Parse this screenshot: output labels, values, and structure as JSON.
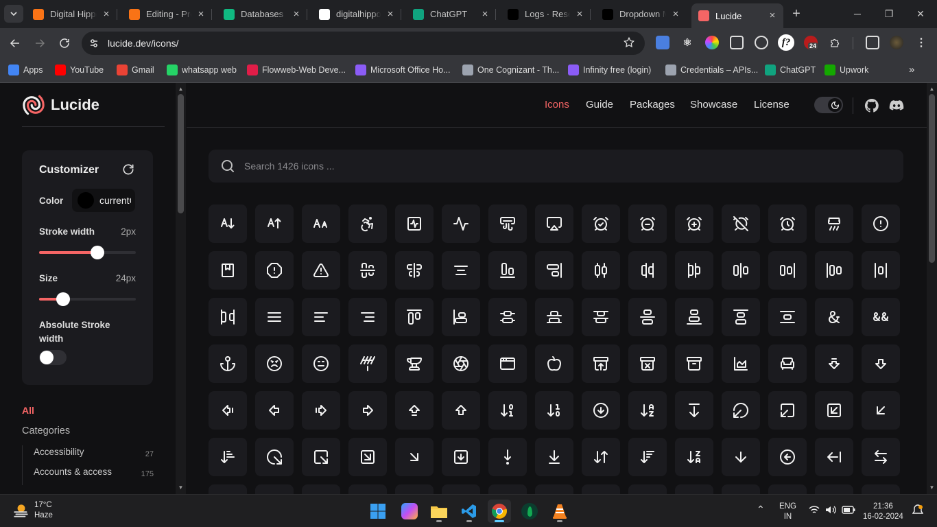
{
  "browser": {
    "tabs": [
      {
        "title": "Digital Hippo",
        "icon": "digitalhippo-icon",
        "color": "#f97316"
      },
      {
        "title": "Editing - Pro",
        "icon": "digitalhippo-icon",
        "color": "#f97316"
      },
      {
        "title": "Databases | C",
        "icon": "mongodb-icon",
        "color": "#10b981"
      },
      {
        "title": "digitalhippo",
        "icon": "github-icon",
        "color": "#ffffff"
      },
      {
        "title": "ChatGPT",
        "icon": "chatgpt-icon",
        "color": "#10a37f"
      },
      {
        "title": "Logs · Resen",
        "icon": "resend-icon",
        "color": "#000000"
      },
      {
        "title": "Dropdown M",
        "icon": "shadcn-icon",
        "color": "#000000"
      },
      {
        "title": "Lucide",
        "icon": "lucide-icon",
        "color": "#f56565",
        "active": true
      }
    ],
    "url": "lucide.dev/icons/",
    "bookmarks": [
      {
        "label": "Apps",
        "icon": "apps-grid-icon",
        "color": "#4285f4"
      },
      {
        "label": "YouTube",
        "icon": "youtube-icon",
        "color": "#ff0000"
      },
      {
        "label": "Gmail",
        "icon": "gmail-icon",
        "color": "#ea4335"
      },
      {
        "label": "whatsapp web",
        "icon": "whatsapp-icon",
        "color": "#25d366"
      },
      {
        "label": "Flowweb-Web Deve...",
        "icon": "flowweb-icon",
        "color": "#e11d48"
      },
      {
        "label": "Microsoft Office Ho...",
        "icon": "office-icon",
        "color": "#8b5cf6"
      },
      {
        "label": "One Cognizant - Th...",
        "icon": "globe-icon",
        "color": "#9ca3af"
      },
      {
        "label": "Infinity free (login)",
        "icon": "infinity-icon",
        "color": "#8b5cf6"
      },
      {
        "label": "Credentials – APIs...",
        "icon": "gcp-icon",
        "color": "#9ca3af"
      },
      {
        "label": "ChatGPT",
        "icon": "chatgpt-icon",
        "color": "#10a37f"
      },
      {
        "label": "Upwork",
        "icon": "upwork-icon",
        "color": "#14a800"
      }
    ],
    "extension_badge": "24"
  },
  "site": {
    "brand": "Lucide",
    "nav": [
      "Icons",
      "Guide",
      "Packages",
      "Showcase",
      "License"
    ],
    "nav_active": "Icons",
    "accent": "#f56565",
    "search_placeholder": "Search 1426 icons ..."
  },
  "customizer": {
    "title": "Customizer",
    "color_label": "Color",
    "color_value": "currentColor",
    "stroke_label": "Stroke width",
    "stroke_value": "2px",
    "stroke_fraction": 0.6,
    "size_label": "Size",
    "size_value": "24px",
    "size_fraction": 0.25,
    "absolute_label": "Absolute Stroke width",
    "absolute_on": false
  },
  "categories": {
    "all": "All",
    "heading": "Categories",
    "items": [
      {
        "label": "Accessibility",
        "count": "27"
      },
      {
        "label": "Accounts & access",
        "count": "175"
      }
    ]
  },
  "icons": [
    "a-arrow-down",
    "a-arrow-up",
    "a-large-small",
    "accessibility",
    "activity-square",
    "activity",
    "air-vent",
    "airplay",
    "alarm-clock-check",
    "alarm-clock-minus",
    "alarm-clock-plus",
    "alarm-clock-off",
    "alarm-clock",
    "alarm-smoke",
    "alert-circle",
    "alert-octagon-square",
    "alert-octagon",
    "alert-triangle",
    "align-center-horizontal",
    "align-center-vertical",
    "align-center",
    "align-end-horizontal",
    "align-end-vertical",
    "align-horizontal-distribute-center",
    "align-horizontal-distribute-end",
    "align-horizontal-distribute-start",
    "align-horizontal-justify-center",
    "align-horizontal-justify-end",
    "align-horizontal-justify-start",
    "align-horizontal-space-around",
    "align-horizontal-space-between",
    "align-justify",
    "align-left",
    "align-right",
    "align-start-horizontal",
    "align-start-vertical",
    "align-vertical-distribute-center",
    "align-vertical-distribute-end",
    "align-vertical-distribute-start",
    "align-vertical-justify-center",
    "align-vertical-justify-end",
    "align-vertical-justify-start",
    "align-vertical-space-around",
    "ampersand",
    "ampersands",
    "anchor",
    "angry",
    "annoyed",
    "antenna",
    "anvil",
    "aperture",
    "app-window",
    "apple",
    "archive-restore",
    "archive-x",
    "archive",
    "area-chart",
    "armchair",
    "arrow-big-down-dash",
    "arrow-big-down",
    "arrow-big-left-dash",
    "arrow-big-left",
    "arrow-big-right-dash",
    "arrow-big-right",
    "arrow-big-up-dash",
    "arrow-big-up",
    "arrow-down-0-1",
    "arrow-down-1-0",
    "arrow-down-circle",
    "arrow-down-a-z",
    "arrow-down-from-line",
    "arrow-down-left-from-circle",
    "arrow-down-left-from-square",
    "arrow-down-left-square",
    "arrow-down-left",
    "arrow-down-narrow-wide",
    "arrow-down-right-from-circle",
    "arrow-down-right-from-square",
    "arrow-down-right-square",
    "arrow-down-right",
    "arrow-down-square",
    "arrow-down-to-dot",
    "arrow-down-to-line",
    "arrow-down-up",
    "arrow-down-wide-narrow",
    "arrow-down-z-a",
    "arrow-down",
    "arrow-left-circle",
    "arrow-left-from-line",
    "arrow-left-right"
  ],
  "taskbar": {
    "temperature": "17°C",
    "condition": "Haze",
    "apps": [
      "windows-start-icon",
      "copilot-icon",
      "file-explorer-icon",
      "vscode-icon",
      "chrome-icon",
      "mongodb-compass-icon",
      "vlc-icon"
    ],
    "language": "ENG",
    "region": "IN",
    "time": "21:36",
    "date": "16-02-2024"
  }
}
